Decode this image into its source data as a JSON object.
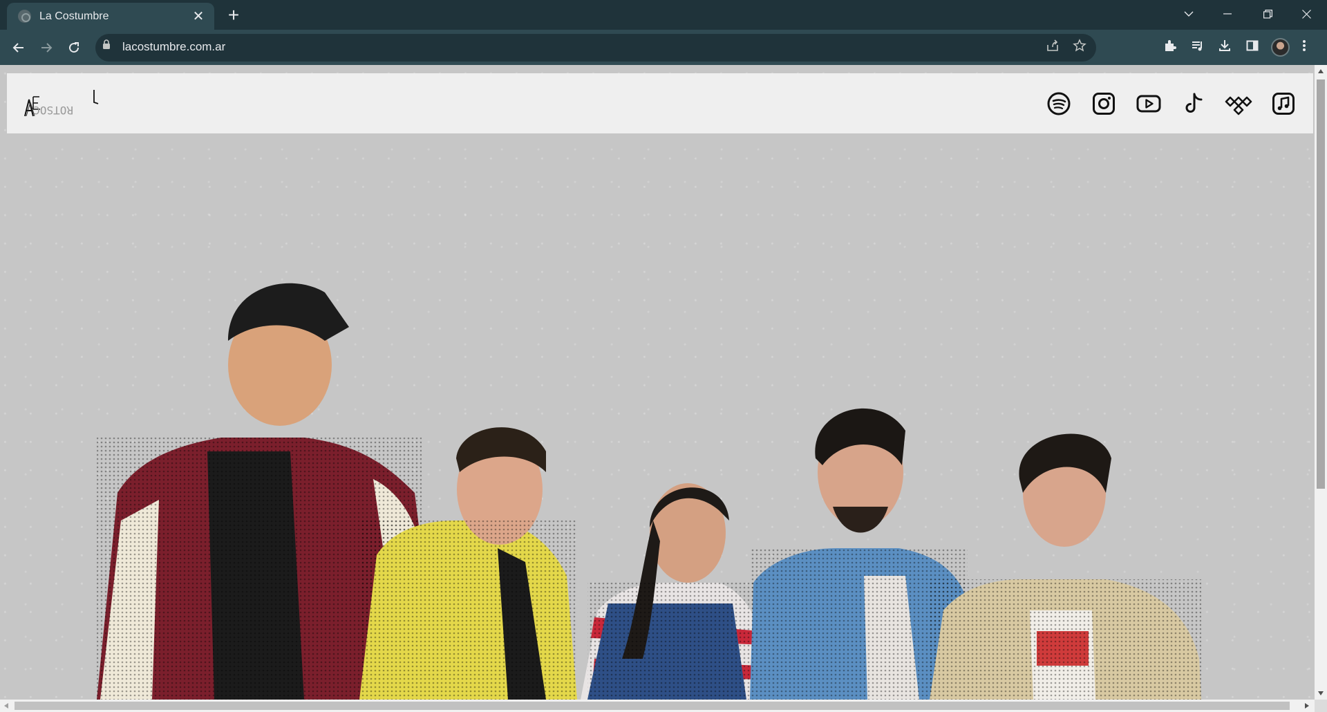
{
  "browser": {
    "tab_title": "La Costumbre",
    "tab_close": "✕",
    "new_tab": "+",
    "url": "lacostumbre.com.ar"
  },
  "site": {
    "logo_text": "LA COSTUMBRE",
    "social": [
      {
        "name": "Spotify",
        "icon": "spotify-icon"
      },
      {
        "name": "Instagram",
        "icon": "instagram-icon"
      },
      {
        "name": "YouTube",
        "icon": "youtube-icon"
      },
      {
        "name": "TikTok",
        "icon": "tiktok-icon"
      },
      {
        "name": "Tidal",
        "icon": "tidal-icon"
      },
      {
        "name": "Apple Music",
        "icon": "apple-music-icon"
      }
    ]
  },
  "colors": {
    "chrome_dark": "#1f333a",
    "chrome_tab": "#2f4a52",
    "page_bg": "#c6c6c6",
    "header_bg": "#efefef"
  }
}
